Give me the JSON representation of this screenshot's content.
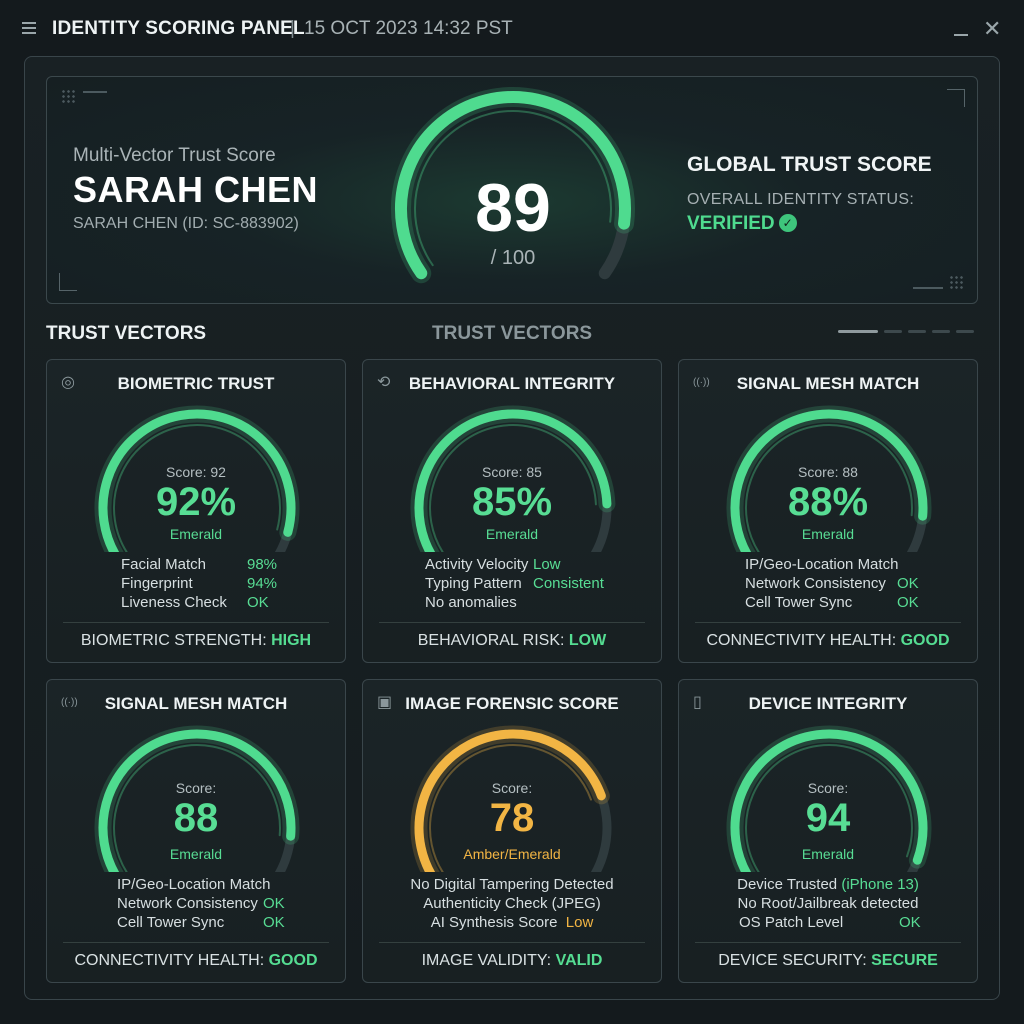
{
  "window": {
    "title": "IDENTITY SCORING PANEL",
    "separator": "|",
    "timestamp": "15 OCT 2023 14:32 PST"
  },
  "hero": {
    "subtitle": "Multi-Vector Trust Score",
    "name": "SARAH CHEN",
    "id_line": "SARAH CHEN (ID: SC-883902)",
    "score": "89",
    "score_total": "/ 100",
    "score_fraction": 0.89,
    "global_title": "GLOBAL TRUST SCORE",
    "status_label": "OVERALL IDENTITY STATUS:",
    "status_value": "VERIFIED",
    "status_icon": "check-circle-icon"
  },
  "section": {
    "title_left": "TRUST VECTORS",
    "title_center": "TRUST VECTORS",
    "pager_active_index": 0,
    "pager_count": 5
  },
  "colors": {
    "emerald": "#4fdb8f",
    "amber": "#f2b544",
    "background": "#141a1d"
  },
  "cards": [
    {
      "icon": "fingerprint-icon",
      "title": "BIOMETRIC TRUST",
      "score_label": "Score: 92",
      "value": "92%",
      "tier": "Emerald",
      "fraction": 0.92,
      "color": "#4fdb8f",
      "metrics": [
        {
          "label": "Facial Match",
          "value": "98%"
        },
        {
          "label": "Fingerprint",
          "value": "94%"
        },
        {
          "label": "Liveness Check",
          "value": "OK"
        }
      ],
      "footer_label": "BIOMETRIC STRENGTH:",
      "footer_value": "HIGH"
    },
    {
      "icon": "behavior-icon",
      "title": "BEHAVIORAL INTEGRITY",
      "score_label": "Score: 85",
      "value": "85%",
      "tier": "Emerald",
      "fraction": 0.85,
      "color": "#4fdb8f",
      "metrics": [
        {
          "label": "Activity Velocity",
          "value": "Low"
        },
        {
          "label": "Typing Pattern",
          "value": "Consistent"
        },
        {
          "label": "No anomalies",
          "value": ""
        }
      ],
      "footer_label": "BEHAVIORAL RISK:",
      "footer_value": "LOW"
    },
    {
      "icon": "signal-tower-icon",
      "title": "SIGNAL MESH MATCH",
      "score_label": "Score: 88",
      "value": "88%",
      "tier": "Emerald",
      "fraction": 0.88,
      "color": "#4fdb8f",
      "metrics": [
        {
          "label": "IP/Geo-Location Match",
          "value": ""
        },
        {
          "label": "Network Consistency",
          "value": "OK"
        },
        {
          "label": "Cell Tower Sync",
          "value": "OK"
        }
      ],
      "footer_label": "CONNECTIVITY HEALTH:",
      "footer_value": "GOOD"
    },
    {
      "icon": "signal-tower-icon",
      "title": "SIGNAL MESH MATCH",
      "score_label": "Score:",
      "value": "88",
      "tier": "Emerald",
      "fraction": 0.88,
      "color": "#4fdb8f",
      "metrics": [
        {
          "label": "IP/Geo-Location Match",
          "value": ""
        },
        {
          "label": "Network Consistency",
          "value": "OK"
        },
        {
          "label": "Cell Tower Sync",
          "value": "OK"
        }
      ],
      "footer_label": "CONNECTIVITY HEALTH:",
      "footer_value": "GOOD"
    },
    {
      "icon": "image-icon",
      "title": "IMAGE FORENSIC SCORE",
      "score_label": "Score:",
      "value": "78",
      "tier": "Amber/Emerald",
      "fraction": 0.78,
      "color": "#f2b544",
      "metrics": [
        {
          "label": "No Digital Tampering Detected",
          "value": ""
        },
        {
          "label": "Authenticity Check (JPEG)",
          "value": ""
        },
        {
          "label": "AI Synthesis Score",
          "value": "Low"
        }
      ],
      "footer_label": "IMAGE VALIDITY:",
      "footer_value": "VALID"
    },
    {
      "icon": "smartphone-icon",
      "title": "DEVICE INTEGRITY",
      "score_label": "Score:",
      "value": "94",
      "tier": "Emerald",
      "fraction": 0.94,
      "color": "#4fdb8f",
      "metrics": [
        {
          "label": "Device Trusted",
          "value": "(iPhone 13)"
        },
        {
          "label": "No Root/Jailbreak detected",
          "value": ""
        },
        {
          "label": "OS Patch Level",
          "value": "OK"
        }
      ],
      "footer_label": "DEVICE SECURITY:",
      "footer_value": "SECURE"
    }
  ]
}
